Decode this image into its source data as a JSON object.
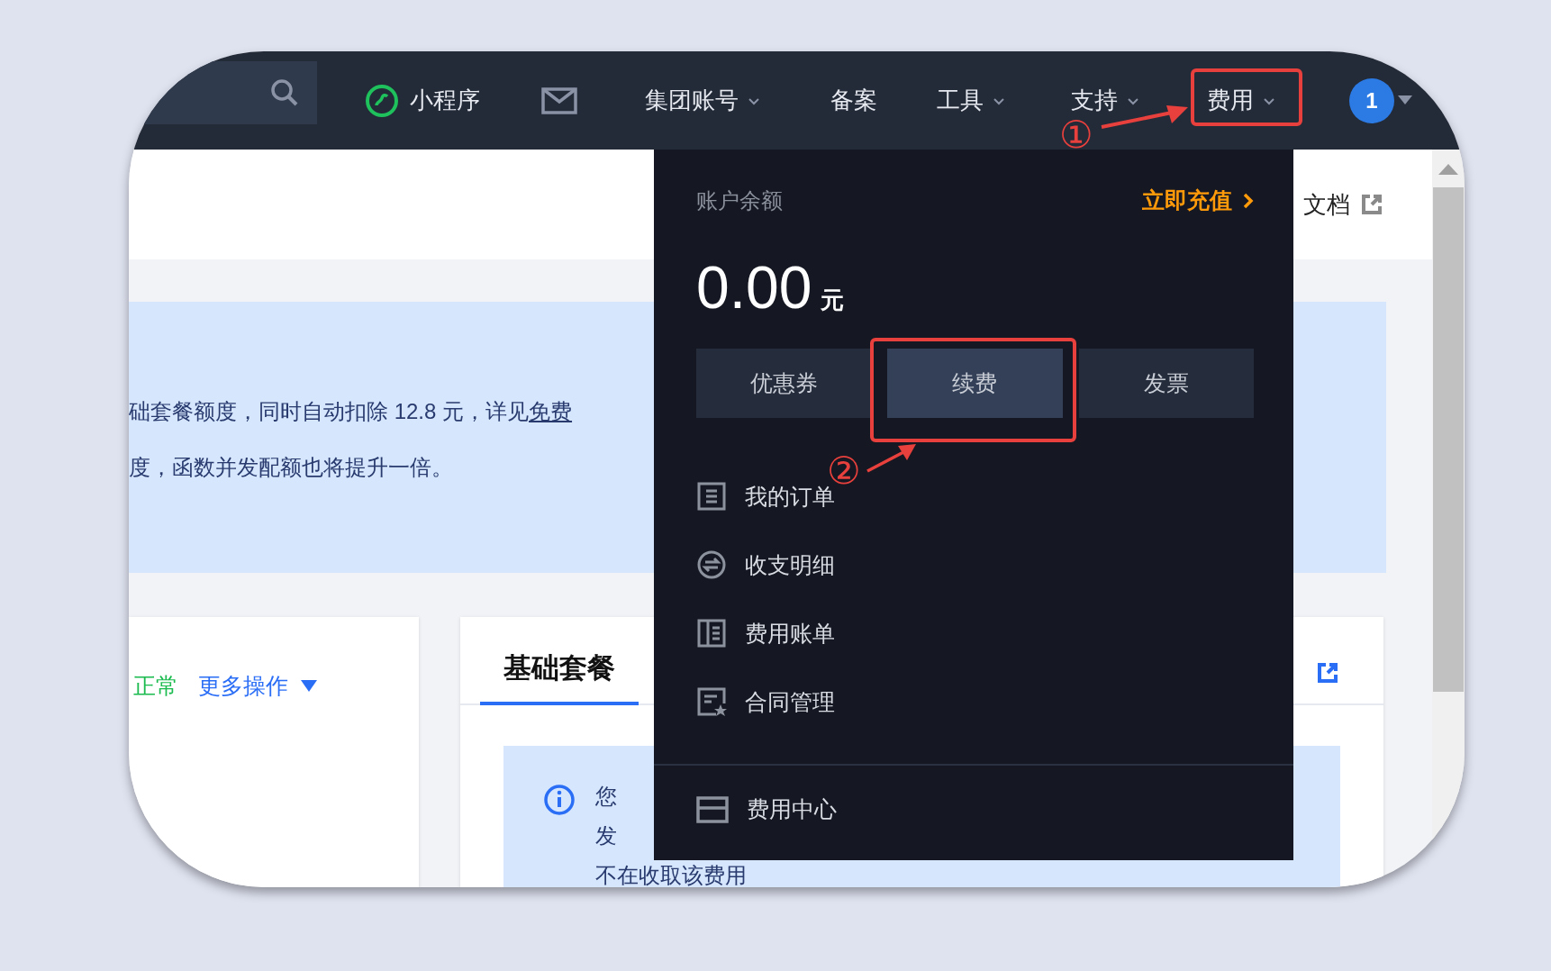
{
  "nav": {
    "mini_program": "小程序",
    "menus": [
      {
        "label": "集团账号",
        "dropdown": true
      },
      {
        "label": "备案",
        "dropdown": false
      },
      {
        "label": "工具",
        "dropdown": true
      },
      {
        "label": "支持",
        "dropdown": true
      },
      {
        "label": "费用",
        "dropdown": true
      }
    ],
    "avatar": "1"
  },
  "header": {
    "doc_link": "文档"
  },
  "banner": {
    "line_1": "础套餐额度，同时自动扣除 12.8 元，详见",
    "line_1_link": "免费",
    "line_2": "度，函数并发配额也将提升一倍。"
  },
  "status_card": {
    "status": "正常",
    "more": "更多操作"
  },
  "plan_card": {
    "tabs": [
      {
        "label": "基础套餐",
        "selected": true
      }
    ],
    "notice": [
      "您",
      "发",
      "不在收取该费用"
    ]
  },
  "billing_menu": {
    "balance_label": "账户余额",
    "recharge": "立即充值",
    "amount": "0.00",
    "unit": "元",
    "actions": [
      {
        "label": "优惠券",
        "selected": false
      },
      {
        "label": "续费",
        "selected": true
      },
      {
        "label": "发票",
        "selected": false
      }
    ],
    "items": [
      {
        "label": "我的订单"
      },
      {
        "label": "收支明细"
      },
      {
        "label": "费用账单"
      },
      {
        "label": "合同管理"
      }
    ],
    "footer": "费用中心"
  },
  "annotations": [
    {
      "label": "①"
    },
    {
      "label": "②"
    }
  ]
}
